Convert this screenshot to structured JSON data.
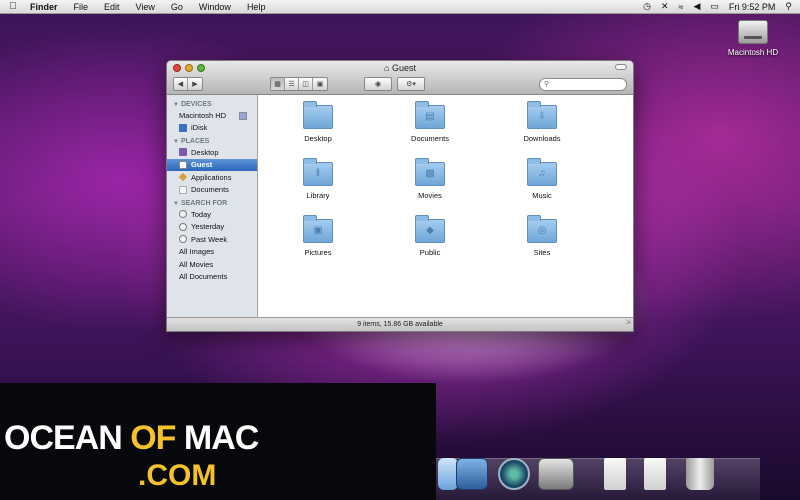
{
  "menubar": {
    "apple_glyph": "",
    "app_name": "Finder",
    "menus": [
      "File",
      "Edit",
      "View",
      "Go",
      "Window",
      "Help"
    ],
    "status_icons": [
      "time-machine-icon",
      "bluetooth-icon",
      "wifi-icon",
      "volume-icon",
      "battery-icon",
      "spotlight-icon"
    ],
    "clock": "Fri 9:52 PM"
  },
  "desktop": {
    "drive_label": "Macintosh HD"
  },
  "window": {
    "title": "Guest",
    "search_placeholder": "",
    "sidebar": {
      "devices_header": "DEVICES",
      "devices": [
        "Macintosh HD",
        "iDisk"
      ],
      "places_header": "PLACES",
      "places": [
        "Desktop",
        "Guest",
        "Applications",
        "Documents"
      ],
      "search_header": "SEARCH FOR",
      "searches": [
        "Today",
        "Yesterday",
        "Past Week",
        "All Images",
        "All Movies",
        "All Documents"
      ],
      "selected": "Guest"
    },
    "items": [
      "Desktop",
      "Documents",
      "Downloads",
      "Library",
      "Movies",
      "Music",
      "Pictures",
      "Public",
      "Sites"
    ],
    "status": "9 items, 15.86 GB available"
  },
  "watermark": {
    "part1": "OCEAN ",
    "part2": "OF",
    "part3": " MAC",
    "part4": ".COM"
  }
}
